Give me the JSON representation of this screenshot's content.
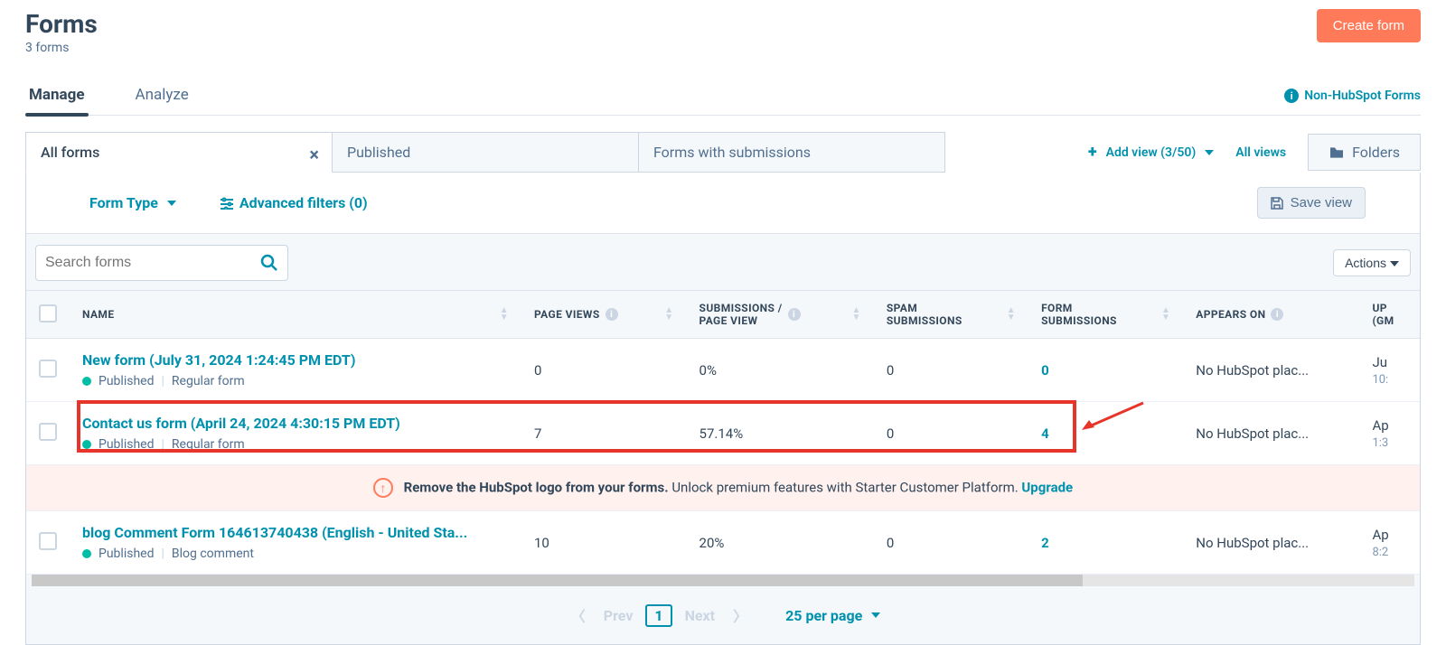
{
  "header": {
    "title": "Forms",
    "subtitle": "3 forms",
    "create_btn": "Create form"
  },
  "tabs": {
    "manage": "Manage",
    "analyze": "Analyze",
    "non_hubspot": "Non-HubSpot Forms"
  },
  "views": {
    "all_forms": "All forms",
    "published": "Published",
    "with_subs": "Forms with submissions",
    "add_view": "Add view (3/50)",
    "all_views": "All views",
    "folders": "Folders"
  },
  "filters": {
    "form_type": "Form Type",
    "advanced": "Advanced filters (0)",
    "save_view": "Save view"
  },
  "search": {
    "placeholder": "Search forms"
  },
  "actions_btn": "Actions",
  "columns": {
    "name": "NAME",
    "page_views": "PAGE VIEWS",
    "subs_per_view_l1": "SUBMISSIONS /",
    "subs_per_view_l2": "PAGE VIEW",
    "spam_l1": "SPAM",
    "spam_l2": "SUBMISSIONS",
    "form_subs_l1": "FORM",
    "form_subs_l2": "SUBMISSIONS",
    "appears_on": "APPEARS ON",
    "updated_l1": "UP",
    "updated_l2": "(GM"
  },
  "rows": [
    {
      "name": "New form (July 31, 2024 1:24:45 PM EDT)",
      "status": "Published",
      "type": "Regular form",
      "page_views": "0",
      "subs_per_view": "0%",
      "spam": "0",
      "form_subs": "0",
      "appears": "No HubSpot plac...",
      "updated_l1": "Ju",
      "updated_l2": "10:"
    },
    {
      "name": "Contact us form (April 24, 2024 4:30:15 PM EDT)",
      "status": "Published",
      "type": "Regular form",
      "page_views": "7",
      "subs_per_view": "57.14%",
      "spam": "0",
      "form_subs": "4",
      "appears": "No HubSpot plac...",
      "updated_l1": "Ap",
      "updated_l2": "1:3"
    },
    {
      "name": "blog Comment Form 164613740438 (English - United Sta...",
      "status": "Published",
      "type": "Blog comment",
      "page_views": "10",
      "subs_per_view": "20%",
      "spam": "0",
      "form_subs": "2",
      "appears": "No HubSpot plac...",
      "updated_l1": "Ap",
      "updated_l2": "8:2"
    }
  ],
  "promo": {
    "bold": "Remove the HubSpot logo from your forms.",
    "rest": " Unlock premium features with Starter Customer Platform. ",
    "upgrade": "Upgrade"
  },
  "pager": {
    "prev": "Prev",
    "page": "1",
    "next": "Next",
    "perpage": "25 per page"
  }
}
